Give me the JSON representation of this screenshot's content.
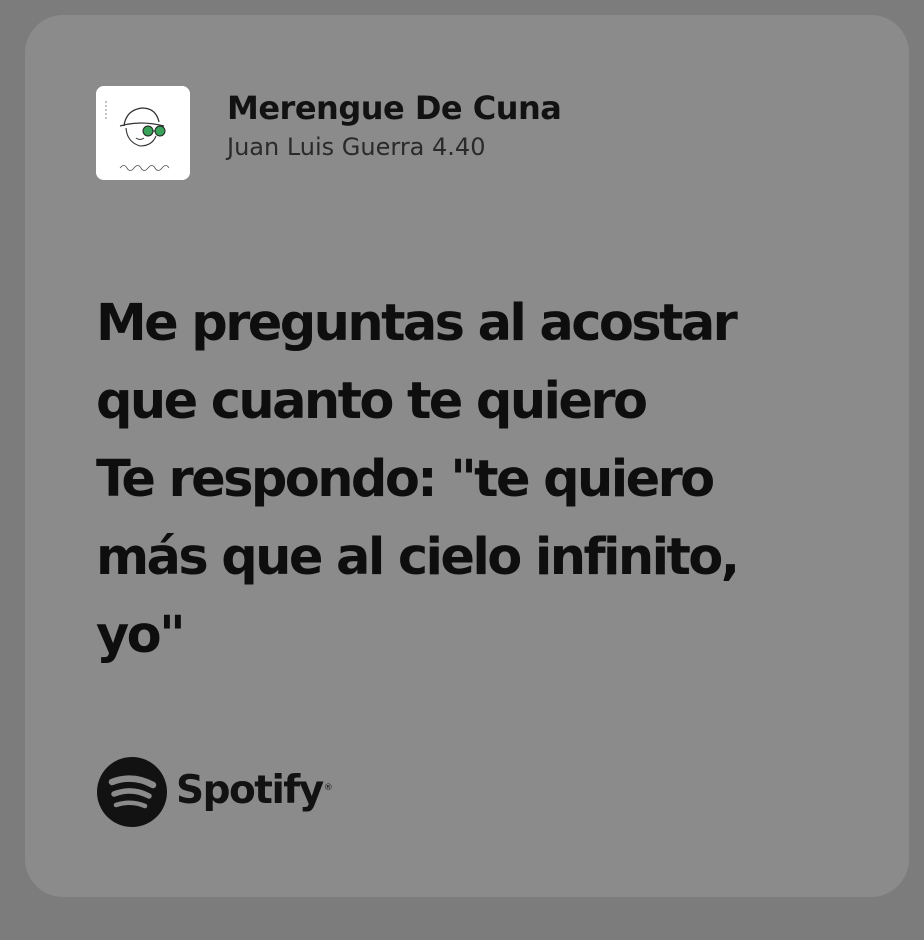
{
  "track": {
    "title": "Merengue De Cuna",
    "artist": "Juan Luis Guerra 4.40",
    "album_art_icon": "album-cover-sketch-icon"
  },
  "lyrics": {
    "lines": [
      "Me preguntas al acostar",
      "que cuanto te quiero",
      "Te respondo: \"te quiero",
      "más que al cielo infinito,",
      "yo\""
    ]
  },
  "brand": {
    "name": "Spotify",
    "registered_mark": "®",
    "logo_icon": "spotify-logo-icon"
  },
  "colors": {
    "background": "#7c7c7c",
    "card": "#8b8b8b",
    "text": "#0e0e0e"
  }
}
